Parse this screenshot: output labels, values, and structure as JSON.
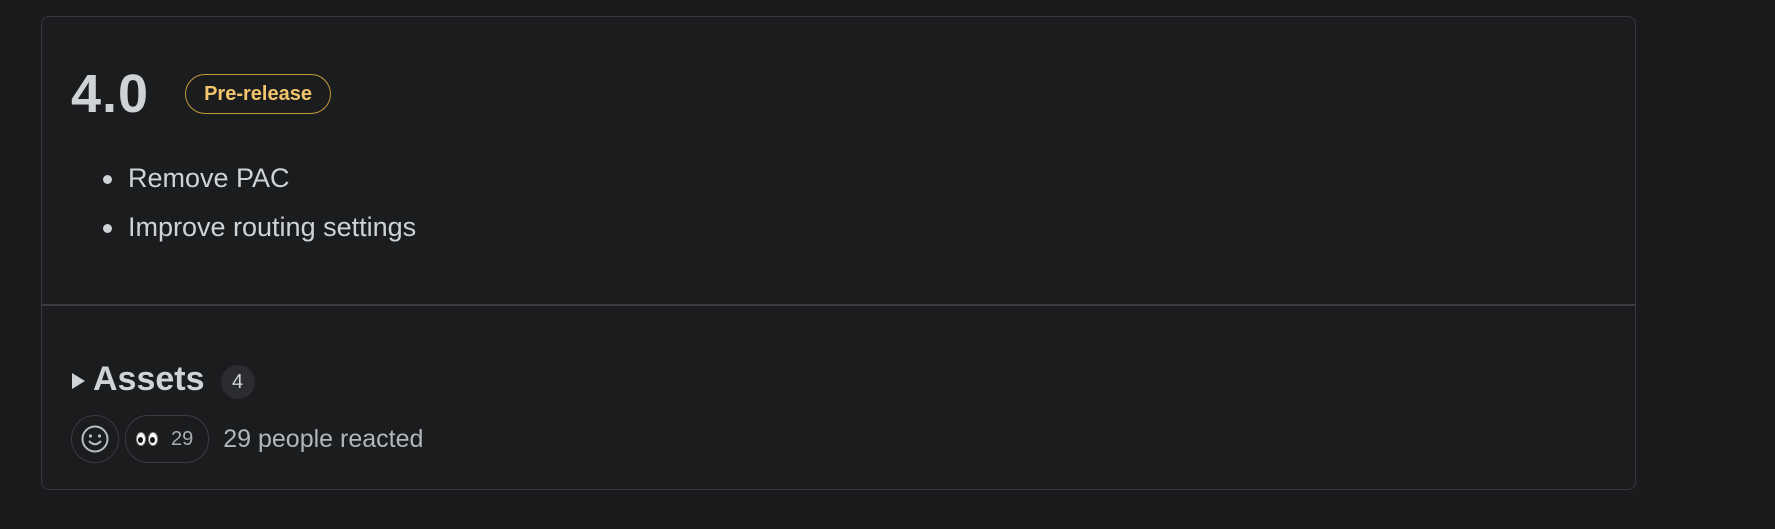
{
  "release": {
    "version": "4.0",
    "badge": "Pre-release",
    "notes": [
      "Remove PAC",
      "Improve routing settings"
    ]
  },
  "assets": {
    "title": "Assets",
    "count": "4"
  },
  "reactions": {
    "add_icon": "smiley-icon",
    "eyes_icon": "eyes-emoji-icon",
    "eyes_count": "29",
    "summary": "29 people reacted"
  },
  "colors": {
    "background": "#1a1b1d",
    "text": "#cfd2d6",
    "badge_border": "#c49a3a",
    "badge_text": "#f2c46c"
  }
}
